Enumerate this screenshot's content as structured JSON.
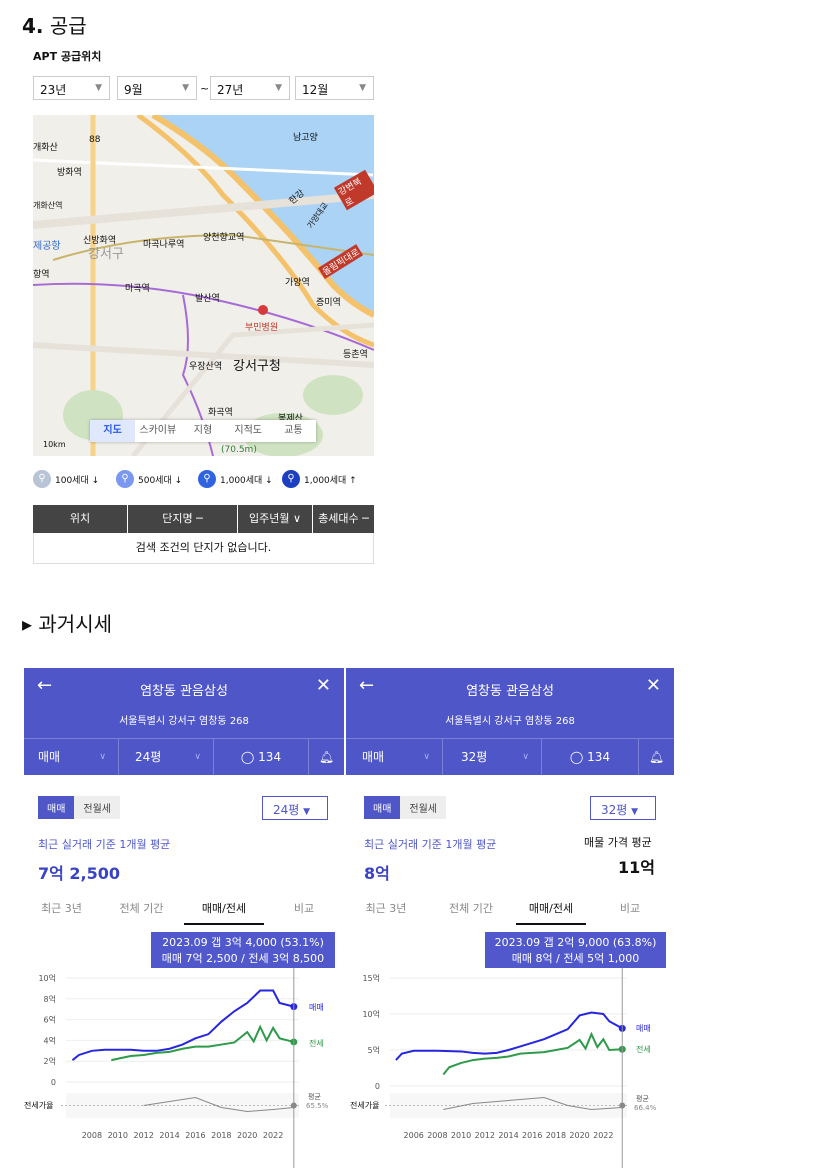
{
  "section": {
    "num": "4.",
    "title": "공급"
  },
  "supply": {
    "subtitle": "APT 공급위치",
    "selects": [
      "23년",
      "9월",
      "27년",
      "12월"
    ],
    "tilde": "~",
    "map_tabs": [
      "지도",
      "스카이뷰",
      "지형",
      "지적도",
      "교통"
    ],
    "map_labels": [
      "남고양",
      "개화산",
      "방화역",
      "개화산역",
      "신방화역",
      "마곡나루역",
      "양천향교역",
      "강서구",
      "마곡역",
      "발산역",
      "가양역",
      "증미역",
      "부민병원",
      "우장산역",
      "강서구청",
      "등촌역",
      "화곡역",
      "봉제산",
      "(70.5m)",
      "88",
      "항역",
      "제공항",
      "강변북로",
      "올림픽대로",
      "가양대교",
      "한강",
      "10km"
    ],
    "legend": [
      "100세대 ↓",
      "500세대 ↓",
      "1,000세대 ↓",
      "1,000세대 ↑"
    ],
    "table_headers": [
      "위치",
      "단지명 ─",
      "입주년월 ∨",
      "총세대수 ─"
    ],
    "table_empty": "검색 조건의 단지가 없습니다."
  },
  "past": {
    "title": "▸ 과거시세"
  },
  "cards": [
    {
      "title": "염창동 관음삼성",
      "address": "서울특별시 강서구 염창동 268",
      "deal": "매매",
      "size": "24평",
      "comments": "134",
      "toggle": [
        "매매",
        "전월세"
      ],
      "size_select": "24평",
      "recent": "최근 실거래 기준 1개월 평균",
      "price": "7억 2,500",
      "tabs": [
        "최근 3년",
        "전체 기간",
        "매매/전세",
        "비교"
      ],
      "tip1": "2023.09  갭 3억 4,000 (53.1%)",
      "tip2": "매매 7억 2,500 / 전세 3억 8,500",
      "ratio_label": "전세가율",
      "avg_label": "평균",
      "avg_value": "65.5%",
      "series_labels": [
        "매매",
        "전세"
      ]
    },
    {
      "title": "염창동 관음삼성",
      "address": "서울특별시 강서구 염창동 268",
      "deal": "매매",
      "size": "32평",
      "comments": "134",
      "toggle": [
        "매매",
        "전월세"
      ],
      "size_select": "32평",
      "recent": "최근 실거래 기준 1개월 평균",
      "price": "8억",
      "listing_label": "매물 가격 평균",
      "listing_price": "11억",
      "tabs": [
        "최근 3년",
        "전체 기간",
        "매매/전세",
        "비교"
      ],
      "tip1": "2023.09  갭 2억 9,000 (63.8%)",
      "tip2": "매매 8억 / 전세 5억 1,000",
      "ratio_label": "전세가율",
      "avg_label": "평균",
      "avg_value": "66.4%",
      "series_labels": [
        "매매",
        "전세"
      ]
    }
  ],
  "chart_data": [
    {
      "type": "line",
      "y_ticks": [
        "10억",
        "8억",
        "6억",
        "4억",
        "2억",
        "0"
      ],
      "x_ticks": [
        "2008",
        "2010",
        "2012",
        "2014",
        "2016",
        "2018",
        "2020",
        "2022"
      ],
      "ylim": [
        0,
        10
      ],
      "series": [
        {
          "name": "매매",
          "color": "#2626e0",
          "points": [
            [
              2006.5,
              2.1
            ],
            [
              2007,
              2.6
            ],
            [
              2008,
              3.0
            ],
            [
              2009,
              3.1
            ],
            [
              2010,
              3.1
            ],
            [
              2011,
              3.1
            ],
            [
              2012,
              3.0
            ],
            [
              2013,
              3.0
            ],
            [
              2014,
              3.2
            ],
            [
              2015,
              3.6
            ],
            [
              2016,
              4.2
            ],
            [
              2017,
              4.6
            ],
            [
              2018,
              5.8
            ],
            [
              2019,
              6.8
            ],
            [
              2020,
              7.6
            ],
            [
              2021,
              8.8
            ],
            [
              2022,
              8.8
            ],
            [
              2022.5,
              7.6
            ],
            [
              2023.6,
              7.25
            ]
          ]
        },
        {
          "name": "전세",
          "color": "#2e9a4a",
          "points": [
            [
              2009.5,
              2.1
            ],
            [
              2011,
              2.5
            ],
            [
              2012,
              2.6
            ],
            [
              2013,
              2.8
            ],
            [
              2014,
              2.9
            ],
            [
              2015,
              3.2
            ],
            [
              2016,
              3.4
            ],
            [
              2017,
              3.4
            ],
            [
              2018,
              3.6
            ],
            [
              2019,
              3.8
            ],
            [
              2020,
              4.8
            ],
            [
              2020.5,
              3.9
            ],
            [
              2021,
              5.3
            ],
            [
              2021.5,
              4.0
            ],
            [
              2022,
              5.2
            ],
            [
              2022.5,
              4.2
            ],
            [
              2023.6,
              3.85
            ]
          ]
        }
      ],
      "ratio": [
        [
          2012,
          0.4
        ],
        [
          2014,
          0.6
        ],
        [
          2016,
          0.8
        ],
        [
          2018,
          0.3
        ],
        [
          2020,
          0.1
        ],
        [
          2022,
          0.2
        ],
        [
          2023.6,
          0.3
        ]
      ],
      "xlim": [
        2006,
        2024
      ]
    },
    {
      "type": "line",
      "y_ticks": [
        "15억",
        "10억",
        "5억",
        "0"
      ],
      "x_ticks": [
        "2006",
        "2008",
        "2010",
        "2012",
        "2014",
        "2016",
        "2018",
        "2020",
        "2022"
      ],
      "ylim": [
        0,
        15
      ],
      "series": [
        {
          "name": "매매",
          "color": "#2626e0",
          "points": [
            [
              2004.5,
              3.6
            ],
            [
              2005,
              4.5
            ],
            [
              2006,
              4.9
            ],
            [
              2008,
              4.9
            ],
            [
              2010,
              4.8
            ],
            [
              2011,
              4.6
            ],
            [
              2012,
              4.5
            ],
            [
              2013,
              4.6
            ],
            [
              2014,
              5.0
            ],
            [
              2015,
              5.5
            ],
            [
              2016,
              6.0
            ],
            [
              2017,
              6.5
            ],
            [
              2018,
              7.2
            ],
            [
              2019,
              7.9
            ],
            [
              2020,
              9.8
            ],
            [
              2021,
              10.2
            ],
            [
              2022,
              10.0
            ],
            [
              2022.5,
              9.0
            ],
            [
              2023.6,
              8.0
            ]
          ]
        },
        {
          "name": "전세",
          "color": "#2e9a4a",
          "points": [
            [
              2008.5,
              1.6
            ],
            [
              2009,
              2.6
            ],
            [
              2010,
              3.2
            ],
            [
              2011,
              3.6
            ],
            [
              2012,
              3.8
            ],
            [
              2013,
              3.9
            ],
            [
              2014,
              4.1
            ],
            [
              2015,
              4.5
            ],
            [
              2016,
              4.6
            ],
            [
              2017,
              4.7
            ],
            [
              2018,
              5.0
            ],
            [
              2019,
              5.3
            ],
            [
              2020,
              6.4
            ],
            [
              2020.5,
              5.2
            ],
            [
              2021,
              7.2
            ],
            [
              2021.5,
              5.4
            ],
            [
              2022,
              6.5
            ],
            [
              2022.5,
              5.0
            ],
            [
              2023.6,
              5.1
            ]
          ]
        }
      ],
      "ratio": [
        [
          2008.5,
          0.2
        ],
        [
          2011,
          0.5
        ],
        [
          2013,
          0.6
        ],
        [
          2015,
          0.7
        ],
        [
          2017,
          0.8
        ],
        [
          2019,
          0.4
        ],
        [
          2021,
          0.2
        ],
        [
          2023.6,
          0.3
        ]
      ],
      "xlim": [
        2004,
        2024
      ]
    }
  ]
}
